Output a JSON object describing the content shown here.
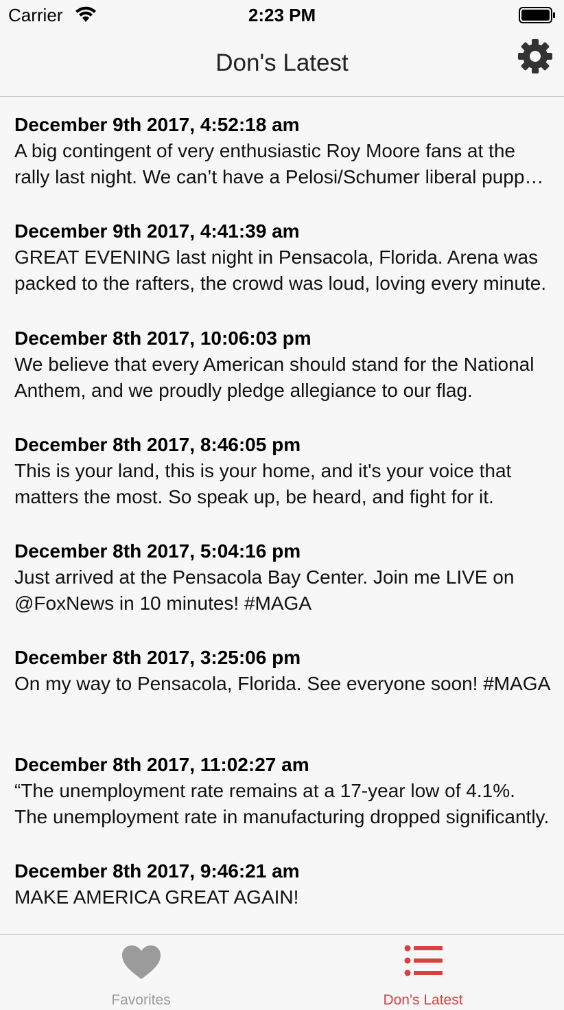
{
  "status_bar": {
    "carrier": "Carrier",
    "time": "2:23 PM"
  },
  "nav": {
    "title": "Don's Latest",
    "settings_icon": "gear-icon"
  },
  "items": [
    {
      "date": "December 9th 2017, 4:52:18 am",
      "text": "A big contingent of very enthusiastic Roy Moore fans at the rally last night. We can’t have a Pelosi/Schumer liberal puppet in Alabama."
    },
    {
      "date": "December 9th 2017, 4:41:39 am",
      "text": "GREAT EVENING last night in Pensacola, Florida. Arena was packed to the rafters, the crowd was loud, loving every minute."
    },
    {
      "date": "December 8th 2017, 10:06:03 pm",
      "text": "We believe that every American should stand for the National Anthem, and we proudly pledge allegiance to our flag."
    },
    {
      "date": "December 8th 2017, 8:46:05 pm",
      "text": "This is your land, this is your home, and it's your voice that matters the most. So speak up, be heard, and fight for it."
    },
    {
      "date": "December 8th 2017, 5:04:16 pm",
      "text": "Just arrived at the Pensacola Bay Center. Join me LIVE on @FoxNews in 10 minutes! #MAGA"
    },
    {
      "date": "December 8th 2017, 3:25:06 pm",
      "text": "On my way to Pensacola, Florida. See everyone soon! #MAGA"
    },
    {
      "date": "December 8th 2017, 11:02:27 am",
      "text": "“The unemployment rate remains at a 17-year low of 4.1%. The unemployment rate in manufacturing dropped significantly."
    },
    {
      "date": "December 8th 2017, 9:46:21 am",
      "text": "MAKE AMERICA GREAT AGAIN!"
    }
  ],
  "tabs": [
    {
      "label": "Favorites",
      "icon": "heart-icon",
      "selected": false
    },
    {
      "label": "Don's Latest",
      "icon": "list-icon",
      "selected": true
    }
  ],
  "colors": {
    "accent": "#d94040",
    "inactive": "#9b9b9b",
    "background": "#f7f7f7"
  }
}
